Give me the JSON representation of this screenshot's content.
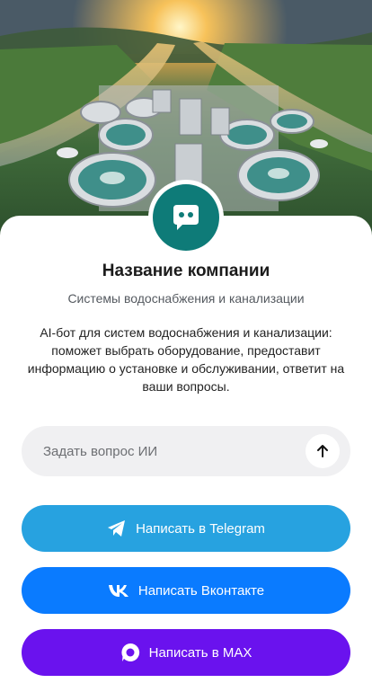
{
  "hero": {
    "image": "water-treatment-plant-photo"
  },
  "profile": {
    "avatar_icon": "chat-bubble-icon",
    "avatar_color": "#0e7b78",
    "company_name": "Название компании",
    "subtitle": "Системы водоснабжения и канализации",
    "description": "AI-бот для систем водоснабжения и канализации: поможет выбрать оборудование, предоставит информацию о установке и обслуживании, ответит на ваши вопросы."
  },
  "ask": {
    "placeholder": "Задать вопрос ИИ",
    "value": "",
    "send_icon": "arrow-up-icon"
  },
  "buttons": {
    "telegram": {
      "label": "Написать в Telegram",
      "icon": "telegram-icon",
      "color": "#27a2e0"
    },
    "vk": {
      "label": "Написать Вконтакте",
      "icon": "vk-icon",
      "color": "#0a7bff"
    },
    "max": {
      "label": "Написать в MAX",
      "icon": "max-icon",
      "color": "#6a12ee"
    }
  }
}
